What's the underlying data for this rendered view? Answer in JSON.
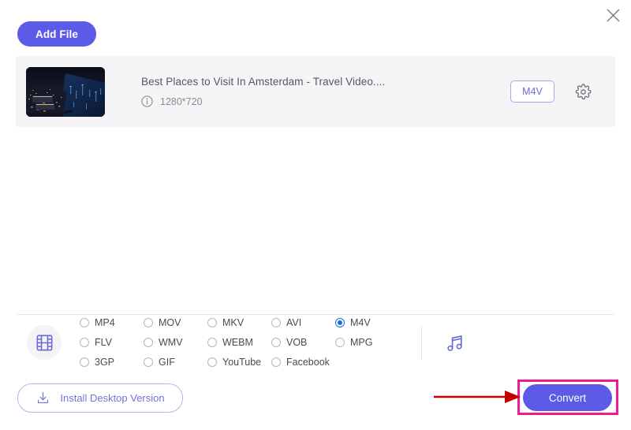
{
  "window": {
    "close_label": "×",
    "close_icon": "close-icon"
  },
  "toolbar": {
    "add_file_label": "Add File"
  },
  "file_list": [
    {
      "title": "Best Places to Visit In Amsterdam - Travel Video....",
      "resolution": "1280*720",
      "info_icon": "info-circle-icon",
      "output_format": "M4V",
      "settings_icon": "gear-icon",
      "thumbnail_alt": "Amsterdam city at night aerial view"
    }
  ],
  "format_bar": {
    "video_icon": "film-strip-icon",
    "audio_icon": "music-note-icon",
    "selected_format": "M4V",
    "options": [
      {
        "label": "MP4",
        "selected": false
      },
      {
        "label": "MOV",
        "selected": false
      },
      {
        "label": "MKV",
        "selected": false
      },
      {
        "label": "AVI",
        "selected": false
      },
      {
        "label": "M4V",
        "selected": true
      },
      {
        "label": "FLV",
        "selected": false
      },
      {
        "label": "WMV",
        "selected": false
      },
      {
        "label": "WEBM",
        "selected": false
      },
      {
        "label": "VOB",
        "selected": false
      },
      {
        "label": "MPG",
        "selected": false
      },
      {
        "label": "3GP",
        "selected": false
      },
      {
        "label": "GIF",
        "selected": false
      },
      {
        "label": "YouTube",
        "selected": false
      },
      {
        "label": "Facebook",
        "selected": false
      }
    ]
  },
  "footer": {
    "install_label": "Install Desktop Version",
    "install_icon": "download-icon",
    "convert_label": "Convert"
  },
  "annotations": {
    "arrow_color": "#c00000",
    "highlight_color": "#ec1c8c",
    "arrow_target": "Convert",
    "highlight_target": "Convert"
  },
  "colors": {
    "accent_purple": "#5b5be8",
    "radio_selected_blue": "#1271d8",
    "row_background": "#f5f5f7"
  }
}
